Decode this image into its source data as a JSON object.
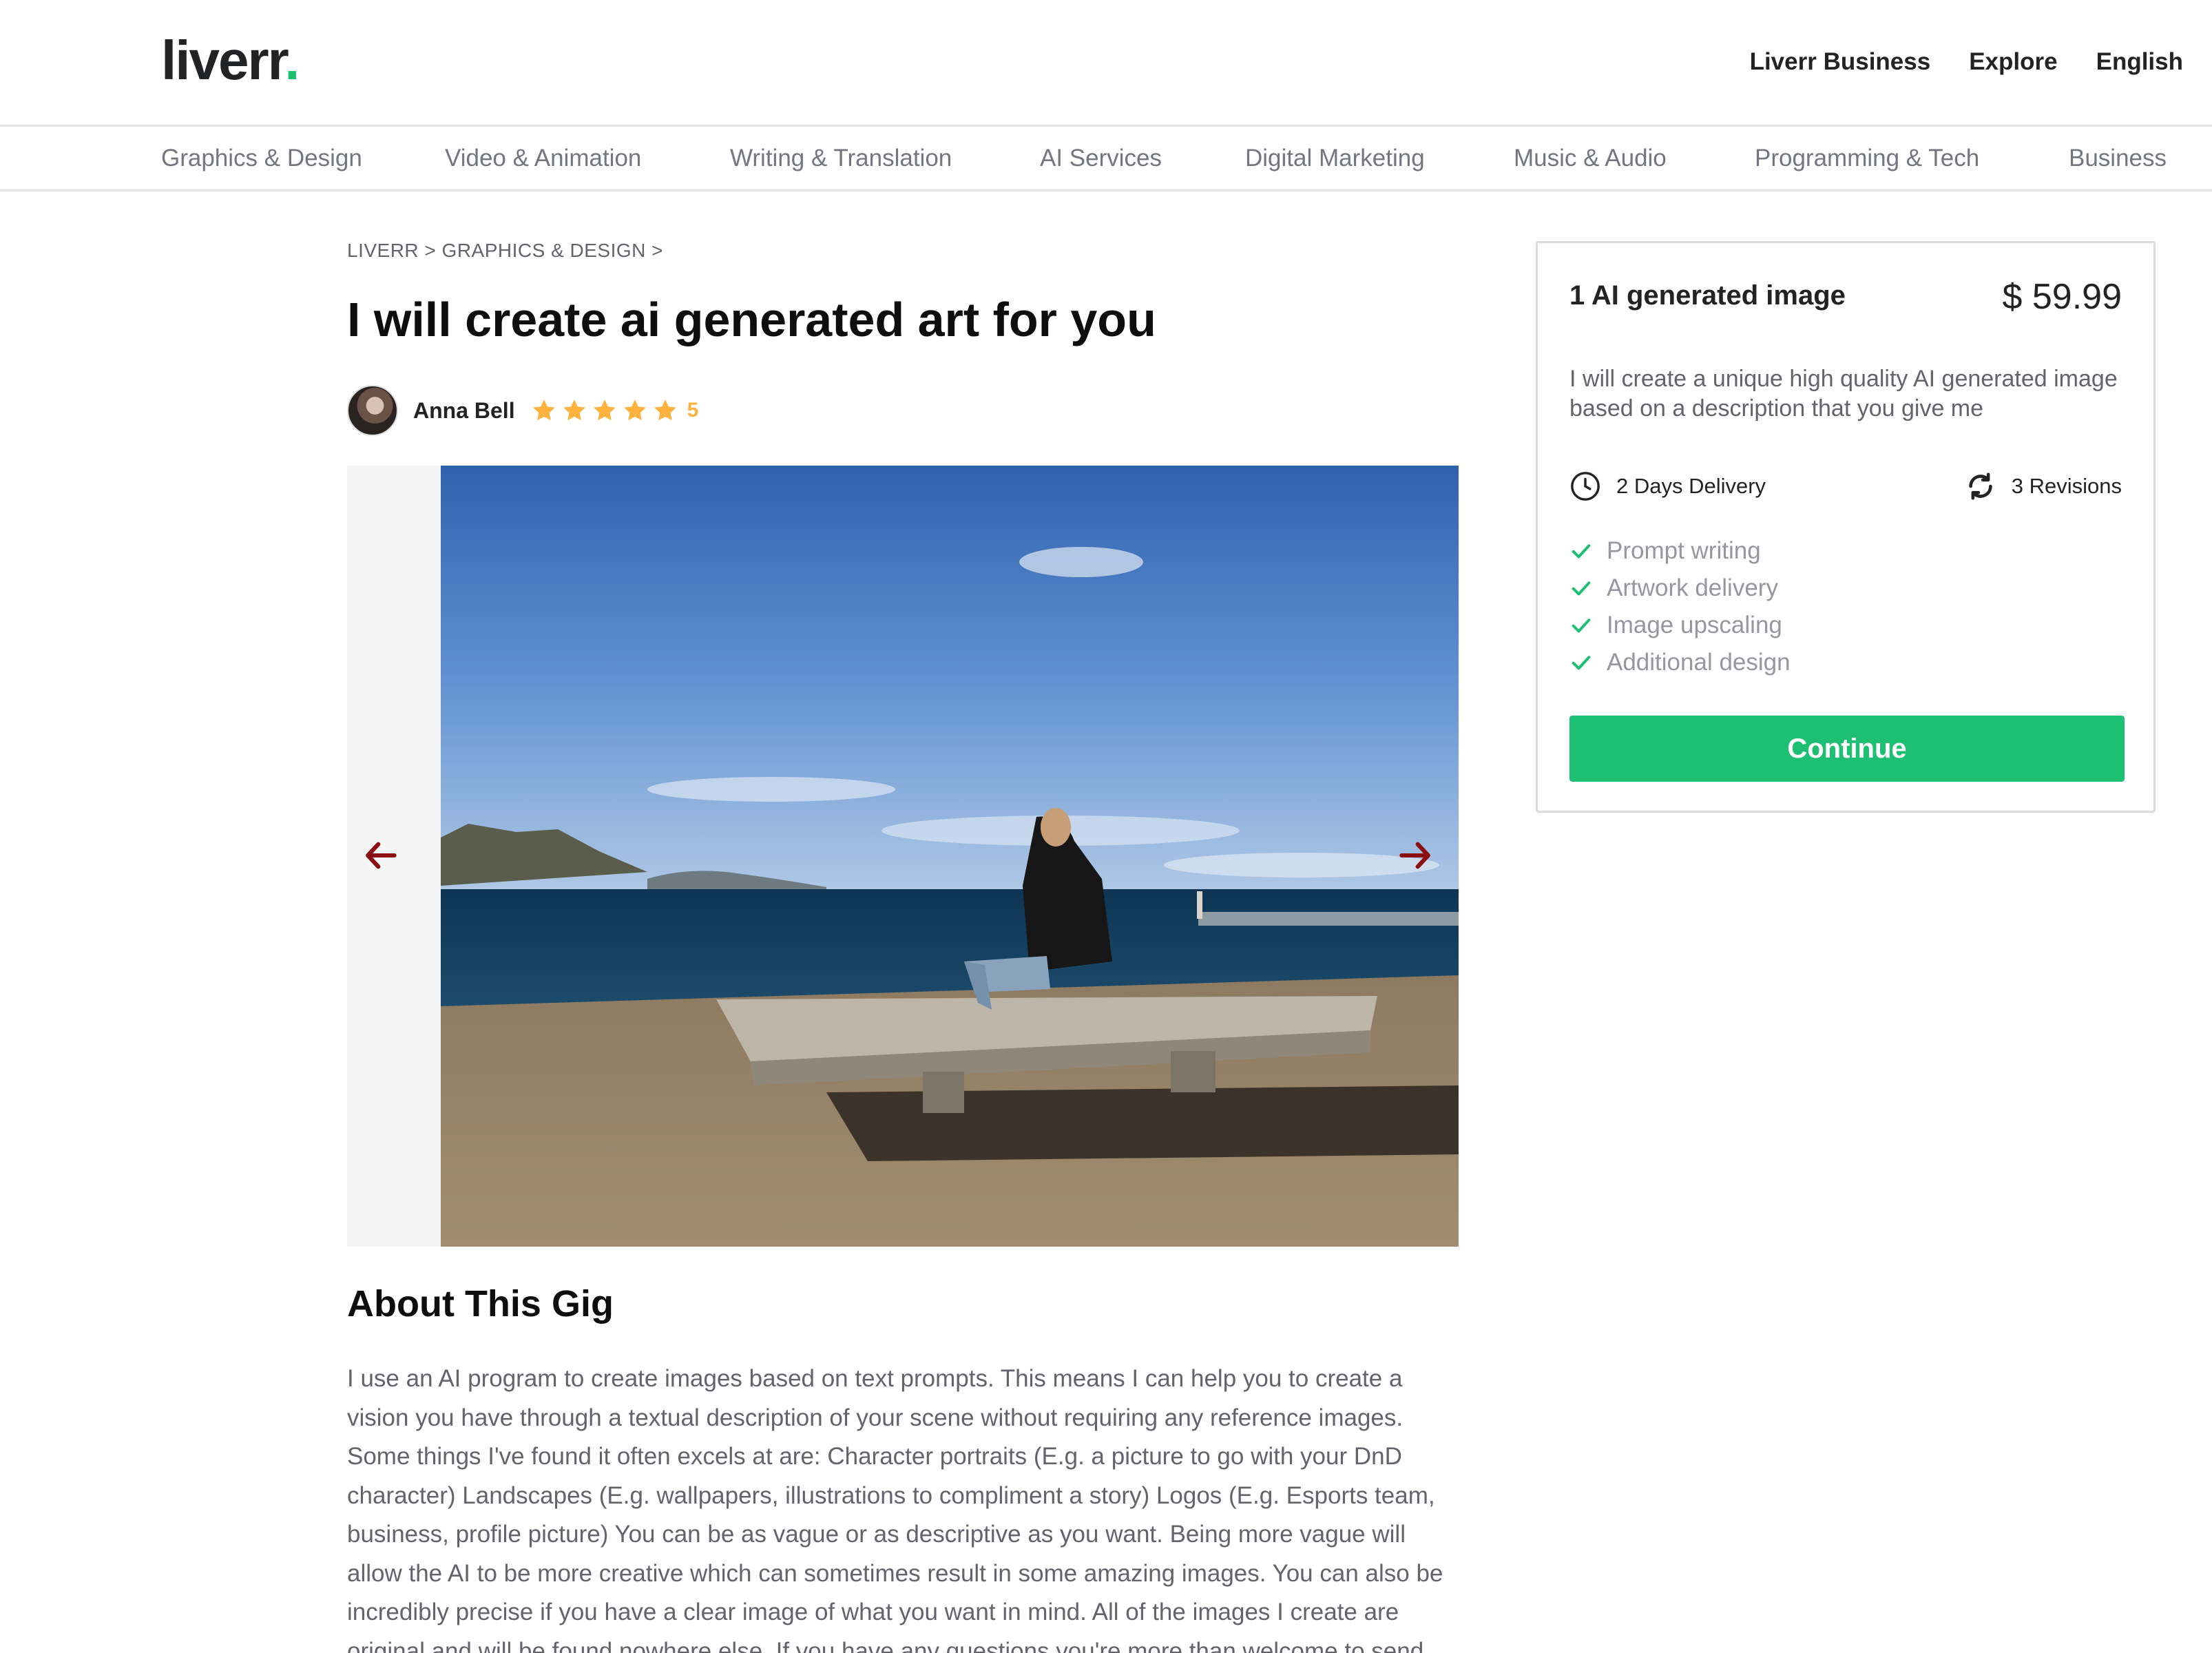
{
  "header": {
    "logo_text": "liverr",
    "logo_dot": ".",
    "nav": [
      "Liverr Business",
      "Explore",
      "English"
    ]
  },
  "categories": [
    "Graphics & Design",
    "Video & Animation",
    "Writing & Translation",
    "AI Services",
    "Digital Marketing",
    "Music & Audio",
    "Programming & Tech",
    "Business"
  ],
  "breadcrumb": "LIVERR > GRAPHICS & DESIGN >",
  "gig": {
    "title": "I will create ai generated art for you",
    "seller_name": "Anna Bell",
    "rating": "5",
    "stars": 5
  },
  "about": {
    "title": "About This Gig",
    "text": "I use an AI program to create images based on text prompts. This means I can help you to create a vision you have through a textual description of your scene without requiring any reference images. Some things I've found it often excels at are: Character portraits (E.g. a picture to go with your DnD character) Landscapes (E.g. wallpapers, illustrations to compliment a story) Logos (E.g. Esports team, business, profile picture) You can be as vague or as descriptive as you want. Being more vague will allow the AI to be more creative which can sometimes result in some amazing images. You can also be incredibly precise if you have a clear image of what you want in mind. All of the images I create are original and will be found nowhere else. If you have any questions you're more than welcome to send"
  },
  "package": {
    "title": "1 AI generated image",
    "price": "$ 59.99",
    "description": "I will create a unique high quality AI generated image based on a description that you give me",
    "delivery": "2 Days Delivery",
    "revisions": "3 Revisions",
    "features": [
      "Prompt writing",
      "Artwork delivery",
      "Image upscaling",
      "Additional design"
    ],
    "cta": "Continue"
  },
  "colors": {
    "brand_green": "#1dbf73",
    "star_yellow": "#ffb33e",
    "arrow_red": "#8a0e12"
  }
}
